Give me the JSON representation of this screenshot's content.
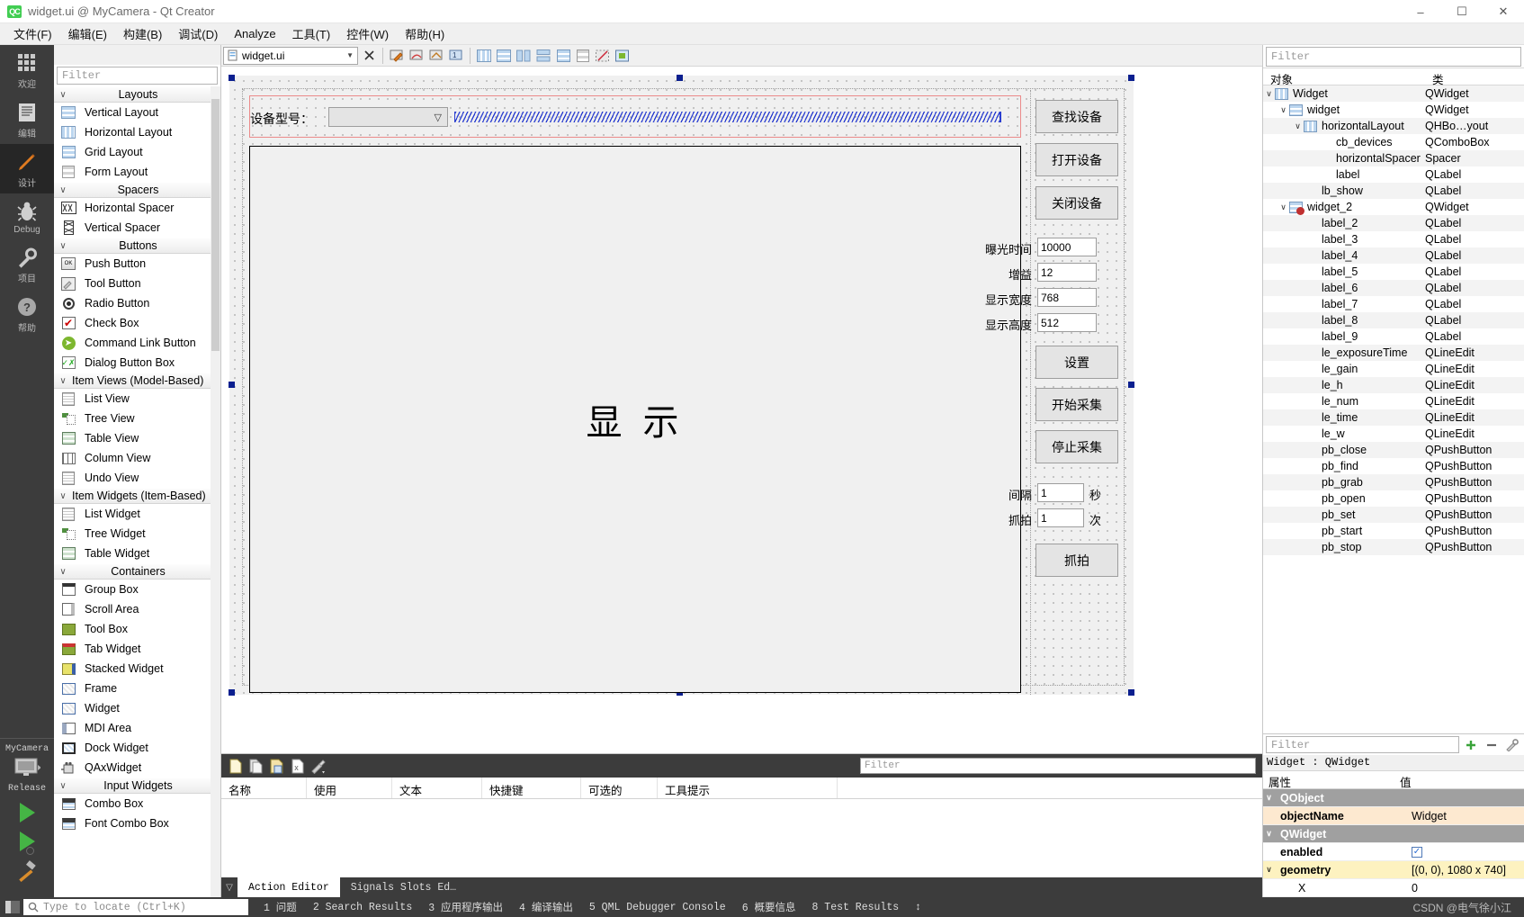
{
  "window": {
    "title": "widget.ui @ MyCamera - Qt Creator",
    "logo": "QC",
    "minimize": "–",
    "maximize": "☐",
    "close": "✕"
  },
  "menubar": [
    {
      "label": "文件(F)"
    },
    {
      "label": "编辑(E)"
    },
    {
      "label": "构建(B)"
    },
    {
      "label": "调试(D)"
    },
    {
      "label": "Analyze"
    },
    {
      "label": "工具(T)"
    },
    {
      "label": "控件(W)"
    },
    {
      "label": "帮助(H)"
    }
  ],
  "modebar": {
    "modes": [
      {
        "label": "欢迎",
        "icon": "grid-icon"
      },
      {
        "label": "编辑",
        "icon": "document-icon"
      },
      {
        "label": "设计",
        "icon": "pencil-icon",
        "active": true
      },
      {
        "label": "Debug",
        "icon": "bug-icon"
      },
      {
        "label": "项目",
        "icon": "wrench-icon"
      },
      {
        "label": "帮助",
        "icon": "question-icon"
      }
    ],
    "kit_name": "MyCamera",
    "kit_build": "Release",
    "run_icon": "run-icon",
    "debug_icon": "debug-run-icon",
    "build_icon": "hammer-icon"
  },
  "widgetbox": {
    "filter_placeholder": "Filter",
    "categories": [
      {
        "name": "Layouts",
        "items": [
          {
            "label": "Vertical Layout",
            "icon": "vertical-layout-icon"
          },
          {
            "label": "Horizontal Layout",
            "icon": "horizontal-layout-icon"
          },
          {
            "label": "Grid Layout",
            "icon": "grid-layout-icon"
          },
          {
            "label": "Form Layout",
            "icon": "form-layout-icon"
          }
        ]
      },
      {
        "name": "Spacers",
        "items": [
          {
            "label": "Horizontal Spacer",
            "icon": "horizontal-spacer-icon"
          },
          {
            "label": "Vertical Spacer",
            "icon": "vertical-spacer-icon"
          }
        ]
      },
      {
        "name": "Buttons",
        "items": [
          {
            "label": "Push Button",
            "icon": "push-button-icon"
          },
          {
            "label": "Tool Button",
            "icon": "tool-button-icon"
          },
          {
            "label": "Radio Button",
            "icon": "radio-button-icon"
          },
          {
            "label": "Check Box",
            "icon": "check-box-icon"
          },
          {
            "label": "Command Link Button",
            "icon": "command-link-icon"
          },
          {
            "label": "Dialog Button Box",
            "icon": "dialog-button-box-icon"
          }
        ]
      },
      {
        "name": "Item Views (Model-Based)",
        "left_aligned": true,
        "items": [
          {
            "label": "List View",
            "icon": "list-view-icon"
          },
          {
            "label": "Tree View",
            "icon": "tree-view-icon"
          },
          {
            "label": "Table View",
            "icon": "table-view-icon"
          },
          {
            "label": "Column View",
            "icon": "column-view-icon"
          },
          {
            "label": "Undo View",
            "icon": "undo-view-icon"
          }
        ]
      },
      {
        "name": "Item Widgets (Item-Based)",
        "left_aligned": true,
        "items": [
          {
            "label": "List Widget",
            "icon": "list-widget-icon"
          },
          {
            "label": "Tree Widget",
            "icon": "tree-widget-icon"
          },
          {
            "label": "Table Widget",
            "icon": "table-widget-icon"
          }
        ]
      },
      {
        "name": "Containers",
        "items": [
          {
            "label": "Group Box",
            "icon": "group-box-icon"
          },
          {
            "label": "Scroll Area",
            "icon": "scroll-area-icon"
          },
          {
            "label": "Tool Box",
            "icon": "tool-box-icon"
          },
          {
            "label": "Tab Widget",
            "icon": "tab-widget-icon"
          },
          {
            "label": "Stacked Widget",
            "icon": "stacked-widget-icon"
          },
          {
            "label": "Frame",
            "icon": "frame-icon"
          },
          {
            "label": "Widget",
            "icon": "widget-icon"
          },
          {
            "label": "MDI Area",
            "icon": "mdi-area-icon"
          },
          {
            "label": "Dock Widget",
            "icon": "dock-widget-icon"
          },
          {
            "label": "QAxWidget",
            "icon": "qax-widget-icon"
          }
        ]
      },
      {
        "name": "Input Widgets",
        "items": [
          {
            "label": "Combo Box",
            "icon": "combo-box-icon"
          },
          {
            "label": "Font Combo Box",
            "icon": "font-combo-box-icon"
          }
        ]
      }
    ]
  },
  "formtoolbar": {
    "file_combo_value": "widget.ui",
    "close_label": "✕"
  },
  "form": {
    "device_label": "设备型号：",
    "display_text": "显 示",
    "buttons_top": [
      {
        "label": "查找设备"
      },
      {
        "label": "打开设备"
      },
      {
        "label": "关闭设备"
      }
    ],
    "fields": [
      {
        "label": "曝光时间",
        "value": "10000"
      },
      {
        "label": "增益",
        "value": "12"
      },
      {
        "label": "显示宽度",
        "value": "768"
      },
      {
        "label": "显示高度",
        "value": "512"
      }
    ],
    "buttons_mid": [
      {
        "label": "设置"
      },
      {
        "label": "开始采集"
      },
      {
        "label": "停止采集"
      }
    ],
    "fields_bottom": [
      {
        "label": "间隔",
        "value": "1",
        "unit": "秒"
      },
      {
        "label": "抓拍",
        "value": "1",
        "unit": "次"
      }
    ],
    "button_grab": "抓拍"
  },
  "actioneditor": {
    "filter_placeholder": "Filter",
    "icons": [
      "new-icon",
      "copy-icon",
      "paste-icon",
      "delete-icon",
      "settings-icon"
    ],
    "columns": [
      "名称",
      "使用",
      "文本",
      "快捷键",
      "可选的",
      "工具提示"
    ],
    "tabs": [
      {
        "label": "Action Editor",
        "active": true
      },
      {
        "label": "Signals Slots Ed…",
        "active": false
      }
    ]
  },
  "objectinspector": {
    "filter_placeholder": "Filter",
    "columns": [
      "对象",
      "类"
    ],
    "rows": [
      {
        "name": "Widget",
        "class": "QWidget",
        "indent": 0,
        "expander": "∨",
        "icon": "hbox-icon",
        "alt": true
      },
      {
        "name": "widget",
        "class": "QWidget",
        "indent": 1,
        "expander": "∨",
        "icon": "vbox-icon",
        "alt": false
      },
      {
        "name": "horizontalLayout",
        "class": "QHBo…yout",
        "indent": 2,
        "expander": "∨",
        "icon": "hbox-icon",
        "alt": true
      },
      {
        "name": "cb_devices",
        "class": "QComboBox",
        "indent": 3,
        "expander": "",
        "icon": "",
        "alt": false
      },
      {
        "name": "horizontalSpacer",
        "class": "Spacer",
        "indent": 3,
        "expander": "",
        "icon": "",
        "alt": true
      },
      {
        "name": "label",
        "class": "QLabel",
        "indent": 3,
        "expander": "",
        "icon": "",
        "alt": false
      },
      {
        "name": "lb_show",
        "class": "QLabel",
        "indent": 2,
        "expander": "",
        "icon": "",
        "alt": true
      },
      {
        "name": "widget_2",
        "class": "QWidget",
        "indent": 1,
        "expander": "∨",
        "icon": "nolayout-icon",
        "alt": false
      },
      {
        "name": "label_2",
        "class": "QLabel",
        "indent": 2,
        "expander": "",
        "icon": "",
        "alt": true
      },
      {
        "name": "label_3",
        "class": "QLabel",
        "indent": 2,
        "expander": "",
        "icon": "",
        "alt": false
      },
      {
        "name": "label_4",
        "class": "QLabel",
        "indent": 2,
        "expander": "",
        "icon": "",
        "alt": true
      },
      {
        "name": "label_5",
        "class": "QLabel",
        "indent": 2,
        "expander": "",
        "icon": "",
        "alt": false
      },
      {
        "name": "label_6",
        "class": "QLabel",
        "indent": 2,
        "expander": "",
        "icon": "",
        "alt": true
      },
      {
        "name": "label_7",
        "class": "QLabel",
        "indent": 2,
        "expander": "",
        "icon": "",
        "alt": false
      },
      {
        "name": "label_8",
        "class": "QLabel",
        "indent": 2,
        "expander": "",
        "icon": "",
        "alt": true
      },
      {
        "name": "label_9",
        "class": "QLabel",
        "indent": 2,
        "expander": "",
        "icon": "",
        "alt": false
      },
      {
        "name": "le_exposureTime",
        "class": "QLineEdit",
        "indent": 2,
        "expander": "",
        "icon": "",
        "alt": true
      },
      {
        "name": "le_gain",
        "class": "QLineEdit",
        "indent": 2,
        "expander": "",
        "icon": "",
        "alt": false
      },
      {
        "name": "le_h",
        "class": "QLineEdit",
        "indent": 2,
        "expander": "",
        "icon": "",
        "alt": true
      },
      {
        "name": "le_num",
        "class": "QLineEdit",
        "indent": 2,
        "expander": "",
        "icon": "",
        "alt": false
      },
      {
        "name": "le_time",
        "class": "QLineEdit",
        "indent": 2,
        "expander": "",
        "icon": "",
        "alt": true
      },
      {
        "name": "le_w",
        "class": "QLineEdit",
        "indent": 2,
        "expander": "",
        "icon": "",
        "alt": false
      },
      {
        "name": "pb_close",
        "class": "QPushButton",
        "indent": 2,
        "expander": "",
        "icon": "",
        "alt": true
      },
      {
        "name": "pb_find",
        "class": "QPushButton",
        "indent": 2,
        "expander": "",
        "icon": "",
        "alt": false
      },
      {
        "name": "pb_grab",
        "class": "QPushButton",
        "indent": 2,
        "expander": "",
        "icon": "",
        "alt": true
      },
      {
        "name": "pb_open",
        "class": "QPushButton",
        "indent": 2,
        "expander": "",
        "icon": "",
        "alt": false
      },
      {
        "name": "pb_set",
        "class": "QPushButton",
        "indent": 2,
        "expander": "",
        "icon": "",
        "alt": true
      },
      {
        "name": "pb_start",
        "class": "QPushButton",
        "indent": 2,
        "expander": "",
        "icon": "",
        "alt": false
      },
      {
        "name": "pb_stop",
        "class": "QPushButton",
        "indent": 2,
        "expander": "",
        "icon": "",
        "alt": true
      }
    ]
  },
  "propertyeditor": {
    "filter_placeholder": "Filter",
    "add_icon": "plus-icon",
    "remove_icon": "minus-icon",
    "config_icon": "wrench-icon",
    "object_line": "Widget : QWidget",
    "columns": [
      "属性",
      "值"
    ],
    "rows": [
      {
        "key": "QObject",
        "value": "",
        "type": "group"
      },
      {
        "key": "objectName",
        "value": "Widget",
        "type": "highlight"
      },
      {
        "key": "QWidget",
        "value": "",
        "type": "group"
      },
      {
        "key": "enabled",
        "value": "",
        "type": "checkbox",
        "checked": true
      },
      {
        "key": "geometry",
        "value": "[(0, 0), 1080 x 740]",
        "type": "expandable",
        "expander": "∨"
      },
      {
        "key": "X",
        "value": "0",
        "type": "child"
      }
    ]
  },
  "statusbar": {
    "locator_placeholder": "Type to locate (Ctrl+K)",
    "search_icon": "search-icon",
    "panel_icon": "output-panel-icon",
    "items": [
      "1 问题",
      "2 Search Results",
      "3 应用程序输出",
      "4 编译输出",
      "5 QML Debugger Console",
      "6 概要信息",
      "8 Test Results"
    ],
    "expander": "↕",
    "watermark": "CSDN @电气徐小江"
  }
}
